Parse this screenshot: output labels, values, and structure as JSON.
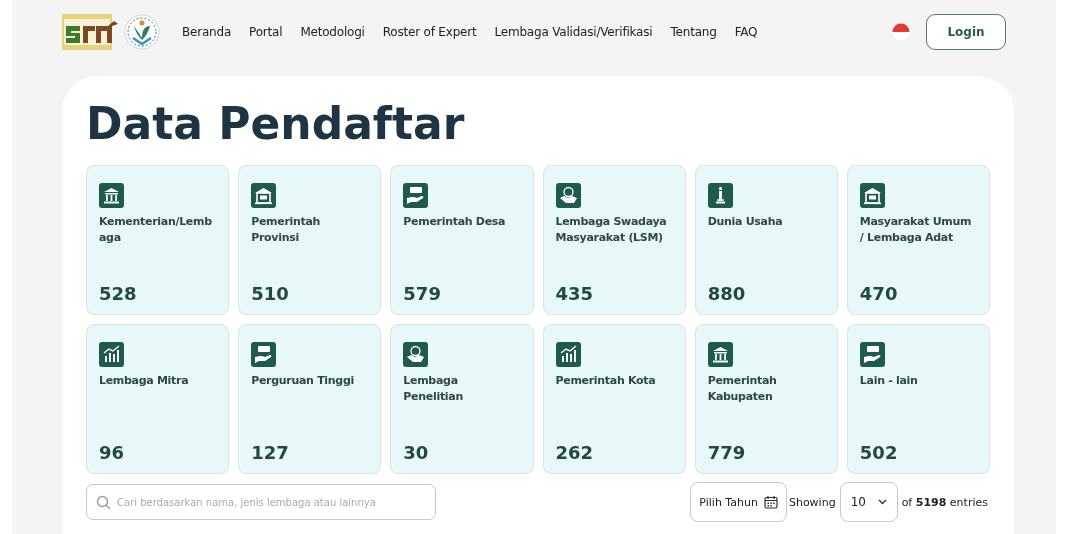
{
  "nav": {
    "links": [
      "Beranda",
      "Portal",
      "Metodologi",
      "Roster of Expert",
      "Lembaga Validasi/Verifikasi",
      "Tentang",
      "FAQ"
    ],
    "login": "Login"
  },
  "title": "Data Pendaftar",
  "cards": [
    {
      "kind": "bank",
      "label": "Kementerian/Lembaga",
      "count": "528"
    },
    {
      "kind": "school",
      "label": "Pemerintah Provinsi",
      "count": "510"
    },
    {
      "kind": "ngo",
      "label": "Pemerintah Desa",
      "count": "579"
    },
    {
      "kind": "handshake",
      "label": "Lembaga Swadaya Masyarakat (LSM)",
      "count": "435"
    },
    {
      "kind": "monument",
      "label": "Dunia Usaha",
      "count": "880"
    },
    {
      "kind": "school",
      "label": "Masyarakat Umum / Lembaga Adat",
      "count": "470"
    },
    {
      "kind": "chart",
      "label": "Lembaga Mitra",
      "count": "96"
    },
    {
      "kind": "ngo",
      "label": "Perguruan Tinggi",
      "count": "127"
    },
    {
      "kind": "handshake",
      "label": "Lembaga Penelitian",
      "count": "30"
    },
    {
      "kind": "chart",
      "label": "Pemerintah Kota",
      "count": "262"
    },
    {
      "kind": "bank",
      "label": "Pemerintah Kabupaten",
      "count": "779"
    },
    {
      "kind": "ngo",
      "label": "Lain - lain",
      "count": "502"
    }
  ],
  "search": {
    "placeholder": "Cari berdasarkan nama, jenis lembaga atau lainnya"
  },
  "year_button": "Pilih Tahun",
  "showing_label": "Showing",
  "page_size": "10",
  "entries": "of **5198** entries"
}
